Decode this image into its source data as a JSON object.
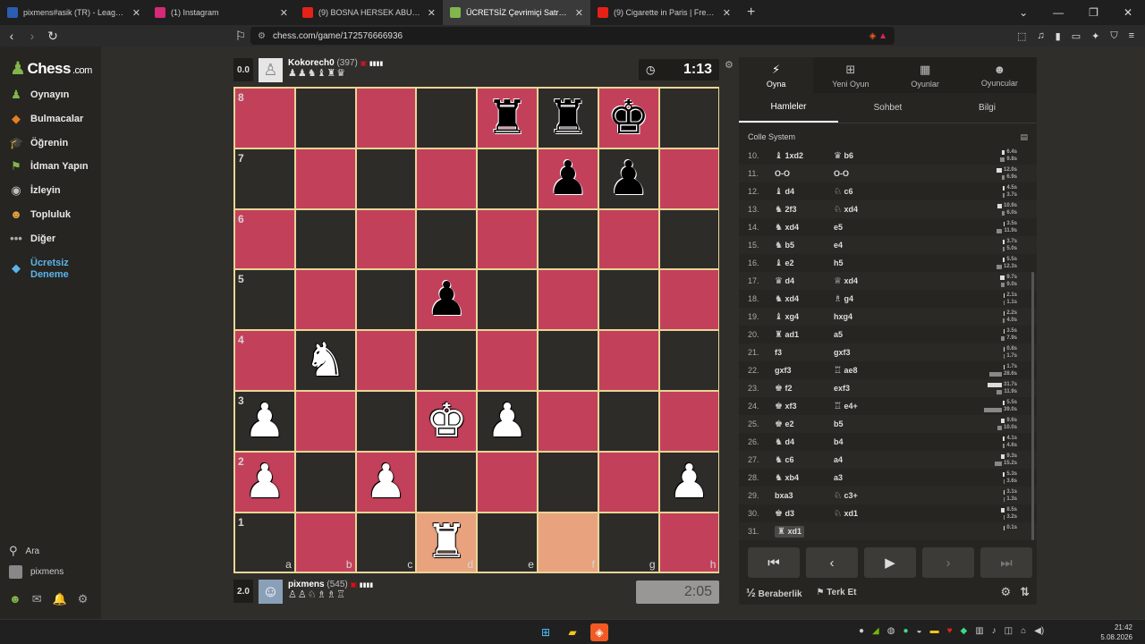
{
  "browser": {
    "tabs": [
      {
        "title": "pixmens#asik (TR) - LeagueOfGraphs",
        "color": "#2a5db0",
        "active": false
      },
      {
        "title": "(1) Instagram",
        "color": "#d62976",
        "active": false
      },
      {
        "title": "(9) BOSNA HERSEK ABUR CUBURLAR",
        "color": "#e62117",
        "active": false
      },
      {
        "title": "ÜCRETSİZ Çevrimiçi Satranç Oyna",
        "color": "#81b64c",
        "active": true
      },
      {
        "title": "(9) Cigarette in Paris | French Emo",
        "color": "#e62117",
        "active": false
      }
    ],
    "url": "chess.com/game/172576666936"
  },
  "sidebar": {
    "logo_text": "Chess",
    "logo_suffix": ".com",
    "items": [
      {
        "label": "Oynayın",
        "icon": "play-icon",
        "glyph": "♟"
      },
      {
        "label": "Bulmacalar",
        "icon": "puzzle-icon",
        "glyph": "◆"
      },
      {
        "label": "Öğrenin",
        "icon": "learn-icon",
        "glyph": "🎓"
      },
      {
        "label": "İdman Yapın",
        "icon": "train-icon",
        "glyph": "⚑"
      },
      {
        "label": "İzleyin",
        "icon": "watch-icon",
        "glyph": "◉"
      },
      {
        "label": "Topluluk",
        "icon": "community-icon",
        "glyph": "☻"
      },
      {
        "label": "Diğer",
        "icon": "more-icon",
        "glyph": "•••"
      }
    ],
    "trial_line1": "Ücretsiz",
    "trial_line2": "Deneme",
    "search_label": "Ara",
    "user_label": "pixmens"
  },
  "game": {
    "top_player": {
      "score": "0.0",
      "name": "Kokorech0",
      "rating": "(397)",
      "captured": "♟♟♞♝♜♛"
    },
    "bottom_player": {
      "score": "2.0",
      "name": "pixmens",
      "rating": "(545)",
      "captured": "♙♙♘♗♗♖"
    },
    "top_clock": "1:13",
    "bottom_clock": "2:05",
    "ranks": [
      "8",
      "7",
      "6",
      "5",
      "4",
      "3",
      "2",
      "1"
    ],
    "files": [
      "a",
      "b",
      "c",
      "d",
      "e",
      "f",
      "g",
      "h"
    ]
  },
  "panel": {
    "tabs": [
      {
        "label": "Oyna",
        "icon": "lightning-icon",
        "glyph": "⚡"
      },
      {
        "label": "Yeni Oyun",
        "icon": "plus-icon",
        "glyph": "⊞"
      },
      {
        "label": "Oyunlar",
        "icon": "board-icon",
        "glyph": "▦"
      },
      {
        "label": "Oyuncular",
        "icon": "players-icon",
        "glyph": "☻"
      }
    ],
    "subtabs": [
      "Hamleler",
      "Sohbet",
      "Bilgi"
    ],
    "opening": "Colle System",
    "moves": [
      {
        "n": "10.",
        "w": "1xd2",
        "wp": "♝",
        "b": "b6",
        "bp": "♛",
        "wt": "6.4s",
        "bt": "9.8s",
        "wv": 6.4,
        "bv": 9.8
      },
      {
        "n": "11.",
        "w": "O-O",
        "wp": "",
        "b": "O-O",
        "bp": "",
        "wt": "12.0s",
        "bt": "6.9s",
        "wv": 12.0,
        "bv": 6.9
      },
      {
        "n": "12.",
        "w": "d4",
        "wp": "♝",
        "b": "c6",
        "bp": "♘",
        "wt": "4.5s",
        "bt": "3.7s",
        "wv": 4.5,
        "bv": 3.7
      },
      {
        "n": "13.",
        "w": "2f3",
        "wp": "♞",
        "b": "xd4",
        "bp": "♘",
        "wt": "10.9s",
        "bt": "6.0s",
        "wv": 10.9,
        "bv": 6.0
      },
      {
        "n": "14.",
        "w": "xd4",
        "wp": "♞",
        "b": "e5",
        "bp": "",
        "wt": "3.5s",
        "bt": "11.9s",
        "wv": 3.5,
        "bv": 11.9
      },
      {
        "n": "15.",
        "w": "b5",
        "wp": "♞",
        "b": "e4",
        "bp": "",
        "wt": "3.7s",
        "bt": "5.0s",
        "wv": 3.7,
        "bv": 5.0
      },
      {
        "n": "16.",
        "w": "e2",
        "wp": "♝",
        "b": "h5",
        "bp": "",
        "wt": "5.5s",
        "bt": "12.3s",
        "wv": 5.5,
        "bv": 12.3
      },
      {
        "n": "17.",
        "w": "d4",
        "wp": "♛",
        "b": "xd4",
        "bp": "♕",
        "wt": "9.7s",
        "bt": "9.0s",
        "wv": 9.7,
        "bv": 9.0
      },
      {
        "n": "18.",
        "w": "xd4",
        "wp": "♞",
        "b": "g4",
        "bp": "♗",
        "wt": "2.1s",
        "bt": "1.1s",
        "wv": 2.1,
        "bv": 1.1
      },
      {
        "n": "19.",
        "w": "xg4",
        "wp": "♝",
        "b": "hxg4",
        "bp": "",
        "wt": "2.2s",
        "bt": "4.0s",
        "wv": 2.2,
        "bv": 4.0
      },
      {
        "n": "20.",
        "w": "ad1",
        "wp": "♜",
        "b": "a5",
        "bp": "",
        "wt": "3.5s",
        "bt": "7.9s",
        "wv": 3.5,
        "bv": 7.9
      },
      {
        "n": "21.",
        "w": "f3",
        "wp": "",
        "b": "gxf3",
        "bp": "",
        "wt": "0.8s",
        "bt": "1.7s",
        "wv": 0.8,
        "bv": 1.7
      },
      {
        "n": "22.",
        "w": "gxf3",
        "wp": "",
        "b": "ae8",
        "bp": "♖",
        "wt": "1.7s",
        "bt": "28.6s",
        "wv": 1.7,
        "bv": 28.6
      },
      {
        "n": "23.",
        "w": "f2",
        "wp": "♚",
        "b": "exf3",
        "bp": "",
        "wt": "31.7s",
        "bt": "11.9s",
        "wv": 31.7,
        "bv": 11.9
      },
      {
        "n": "24.",
        "w": "xf3",
        "wp": "♚",
        "b": "e4+",
        "bp": "♖",
        "wt": "5.5s",
        "bt": "39.0s",
        "wv": 5.5,
        "bv": 39.0
      },
      {
        "n": "25.",
        "w": "e2",
        "wp": "♚",
        "b": "b5",
        "bp": "",
        "wt": "9.6s",
        "bt": "10.0s",
        "wv": 9.6,
        "bv": 10.0
      },
      {
        "n": "26.",
        "w": "d4",
        "wp": "♞",
        "b": "b4",
        "bp": "",
        "wt": "4.1s",
        "bt": "4.6s",
        "wv": 4.1,
        "bv": 4.6
      },
      {
        "n": "27.",
        "w": "c6",
        "wp": "♞",
        "b": "a4",
        "bp": "",
        "wt": "9.3s",
        "bt": "15.2s",
        "wv": 9.3,
        "bv": 15.2
      },
      {
        "n": "28.",
        "w": "xb4",
        "wp": "♞",
        "b": "a3",
        "bp": "",
        "wt": "5.3s",
        "bt": "3.6s",
        "wv": 5.3,
        "bv": 3.6
      },
      {
        "n": "29.",
        "w": "bxa3",
        "wp": "",
        "b": "c3+",
        "bp": "♘",
        "wt": "3.1s",
        "bt": "1.3s",
        "wv": 3.1,
        "bv": 1.3
      },
      {
        "n": "30.",
        "w": "d3",
        "wp": "♚",
        "b": "xd1",
        "bp": "♘",
        "wt": "8.5s",
        "bt": "3.2s",
        "wv": 8.5,
        "bv": 3.2
      },
      {
        "n": "31.",
        "w": "xd1",
        "wp": "♜",
        "b": "",
        "bp": "",
        "wt": "0.1s",
        "bt": "",
        "wv": 0.1,
        "bv": 0
      }
    ],
    "controls": [
      "⏮",
      "‹",
      "▶",
      "›",
      "⏭"
    ],
    "draw_label": "Beraberlik",
    "draw_glyph": "½",
    "resign_label": "Terk Et",
    "resign_glyph": "⚑"
  },
  "taskbar": {
    "time": "21:42",
    "date": "5.08.2026"
  }
}
